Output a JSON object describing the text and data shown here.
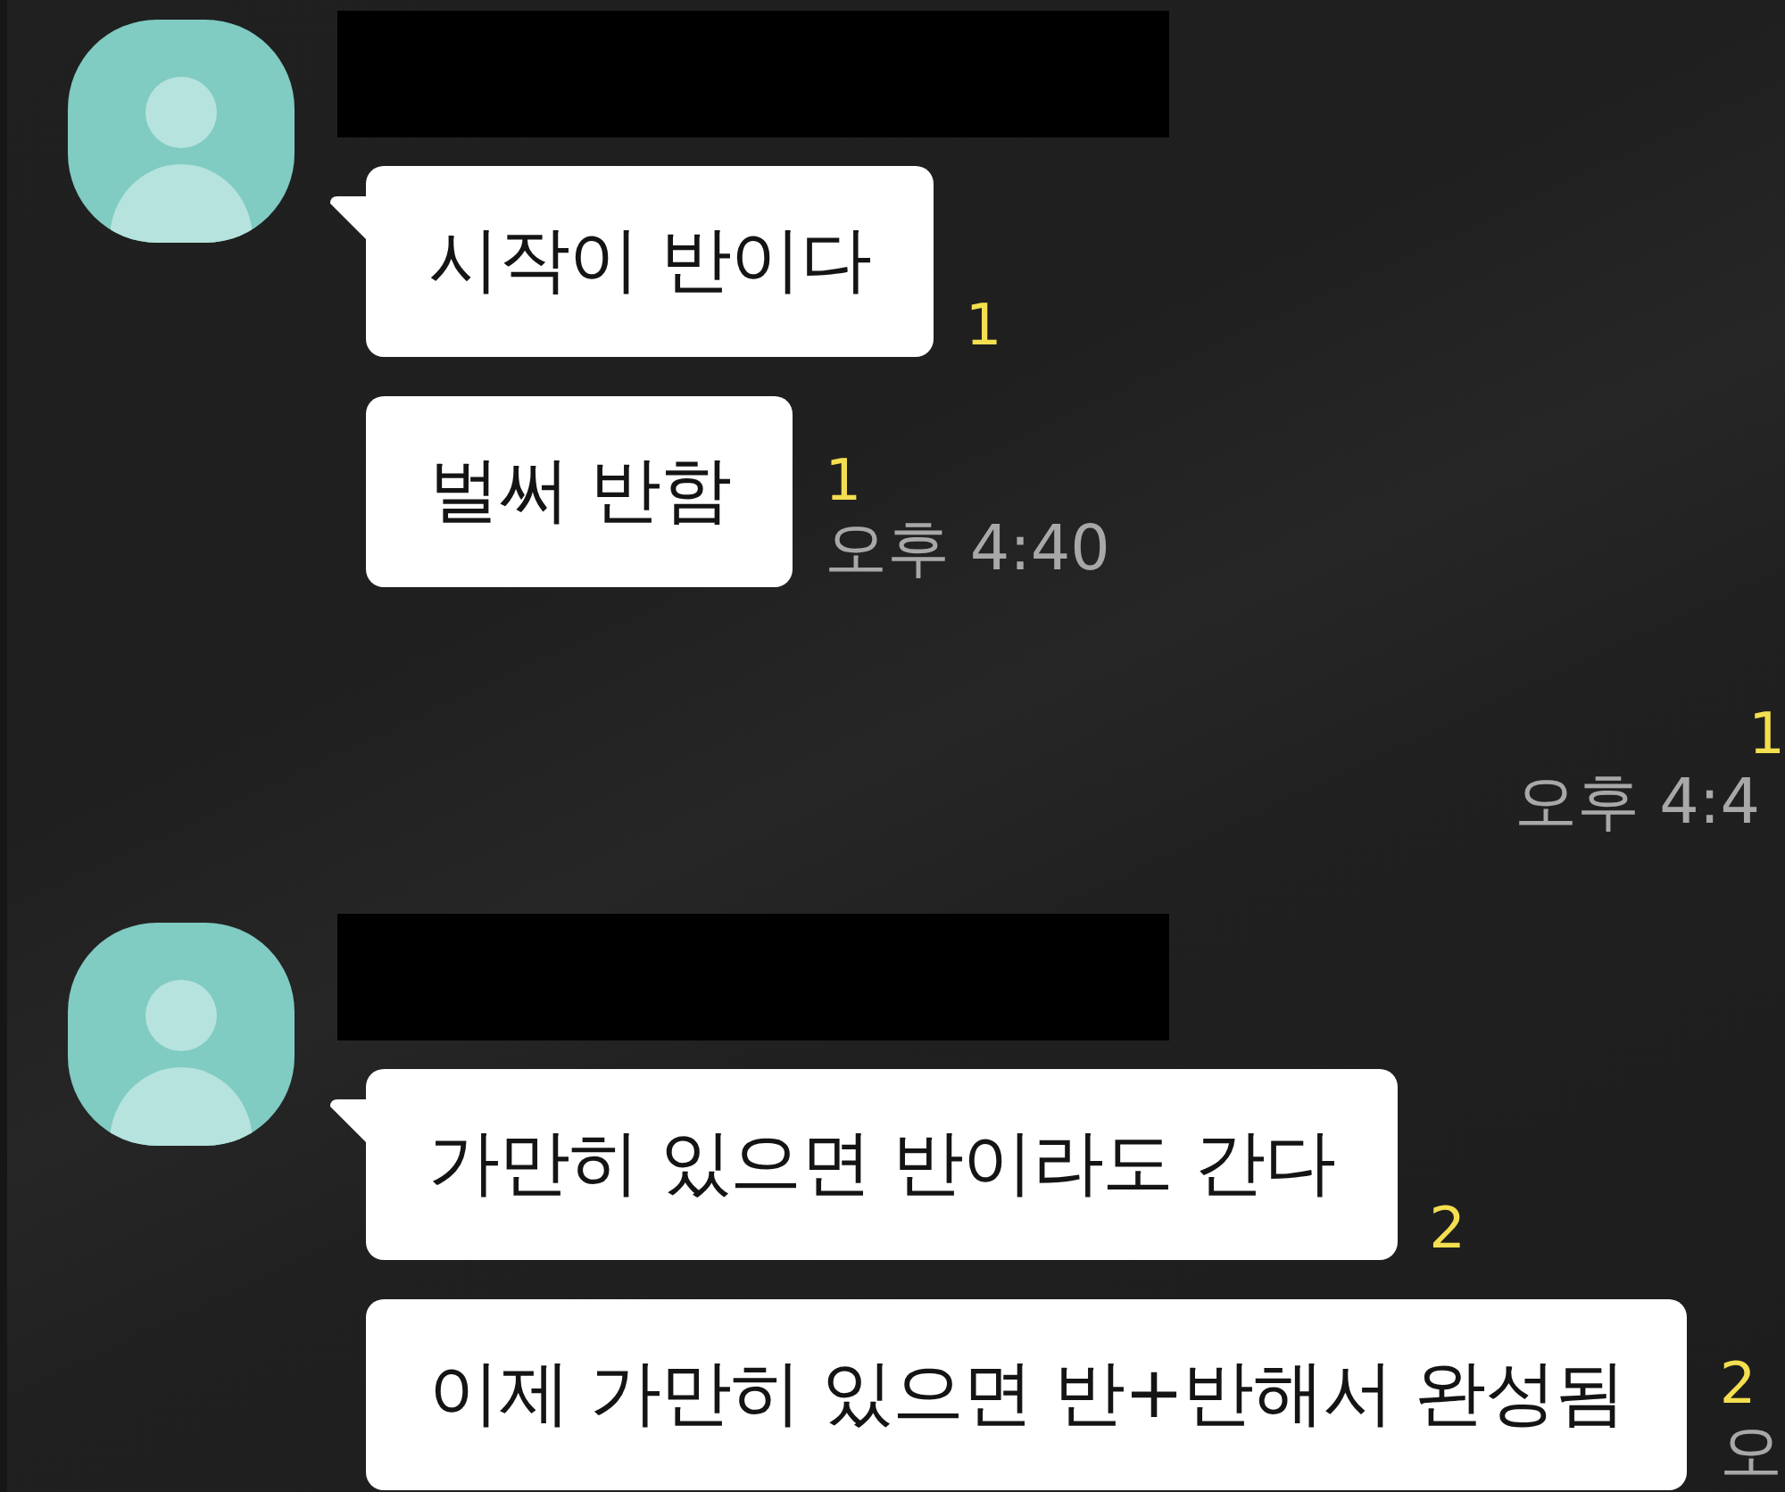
{
  "groups": [
    {
      "kind": "received",
      "messages": [
        {
          "text": "시작이 반이다",
          "unread": "1"
        },
        {
          "text": "벌써 반함",
          "unread": "1",
          "time": "오후 4:40"
        }
      ]
    },
    {
      "kind": "sent",
      "messages": [
        {
          "unread": "1",
          "time": "오후 4:4"
        }
      ]
    },
    {
      "kind": "received",
      "messages": [
        {
          "text": "가만히 있으면 반이라도 간다",
          "unread": "2"
        },
        {
          "text": "이제 가만히 있으면 반+반해서 완성됨",
          "unread": "2",
          "time": "오"
        }
      ]
    }
  ]
}
